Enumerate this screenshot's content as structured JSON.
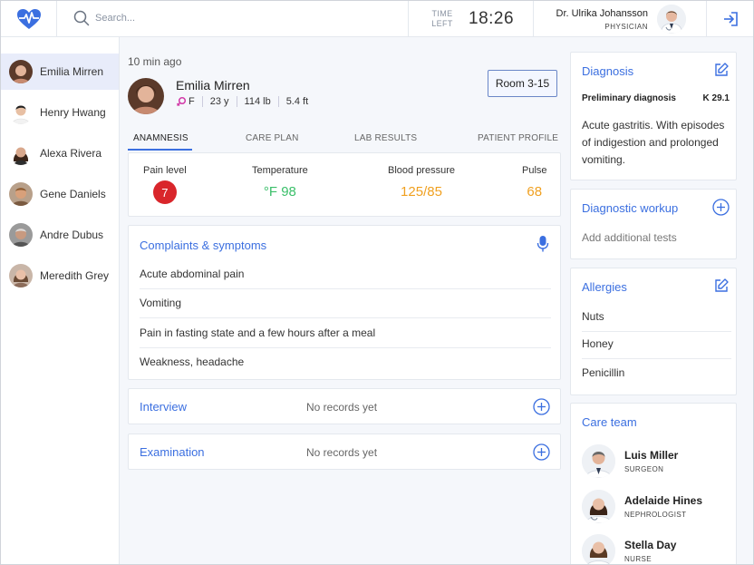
{
  "header": {
    "search_placeholder": "Search...",
    "time_label_1": "TIME",
    "time_label_2": "LEFT",
    "time_value": "18:26",
    "doctor_name": "Dr. Ulrika Johansson",
    "doctor_role": "PHYSICIAN"
  },
  "sidebar": {
    "patients": [
      {
        "name": "Emilia Mirren"
      },
      {
        "name": "Henry Hwang"
      },
      {
        "name": "Alexa Rivera"
      },
      {
        "name": "Gene Daniels"
      },
      {
        "name": "Andre Dubus"
      },
      {
        "name": "Meredith Grey"
      }
    ]
  },
  "patient": {
    "updated": "10 min ago",
    "name": "Emilia Mirren",
    "sex": "F",
    "age": "23 y",
    "weight": "114 lb",
    "height": "5.4 ft",
    "room": "Room 3-15"
  },
  "tabs": [
    "ANAMNESIS",
    "CARE PLAN",
    "LAB RESULTS",
    "PATIENT PROFILE"
  ],
  "vitals": {
    "pain_label": "Pain level",
    "pain_value": "7",
    "temp_label": "Temperature",
    "temp_value": "°F 98",
    "bp_label": "Blood pressure",
    "bp_value": "125/85",
    "pulse_label": "Pulse",
    "pulse_value": "68",
    "colors": {
      "pain": "#d9262b",
      "temp": "#3bbf6a",
      "bp": "#f0a020",
      "pulse": "#f0a020"
    }
  },
  "complaints": {
    "title": "Complaints & symptoms",
    "items": [
      "Acute abdominal pain",
      "Vomiting",
      "Pain in fasting state and a few hours after a meal",
      "Weakness, headache"
    ]
  },
  "interview": {
    "title": "Interview",
    "status": "No records yet"
  },
  "examination": {
    "title": "Examination",
    "status": "No records yet"
  },
  "diagnosis": {
    "title": "Diagnosis",
    "subtitle": "Preliminary diagnosis",
    "code": "K 29.1",
    "text": "Acute gastritis. With episodes of indigestion and prolonged vomiting."
  },
  "workup": {
    "title": "Diagnostic workup",
    "placeholder": "Add additional tests"
  },
  "allergies": {
    "title": "Allergies",
    "items": [
      "Nuts",
      "Honey",
      "Penicillin"
    ]
  },
  "care_team": {
    "title": "Care team",
    "members": [
      {
        "name": "Luis Miller",
        "role": "SURGEON"
      },
      {
        "name": "Adelaide Hines",
        "role": "NEPHROLOGIST"
      },
      {
        "name": "Stella Day",
        "role": "NURSE"
      }
    ]
  },
  "accent_color": "#3b6fe0"
}
